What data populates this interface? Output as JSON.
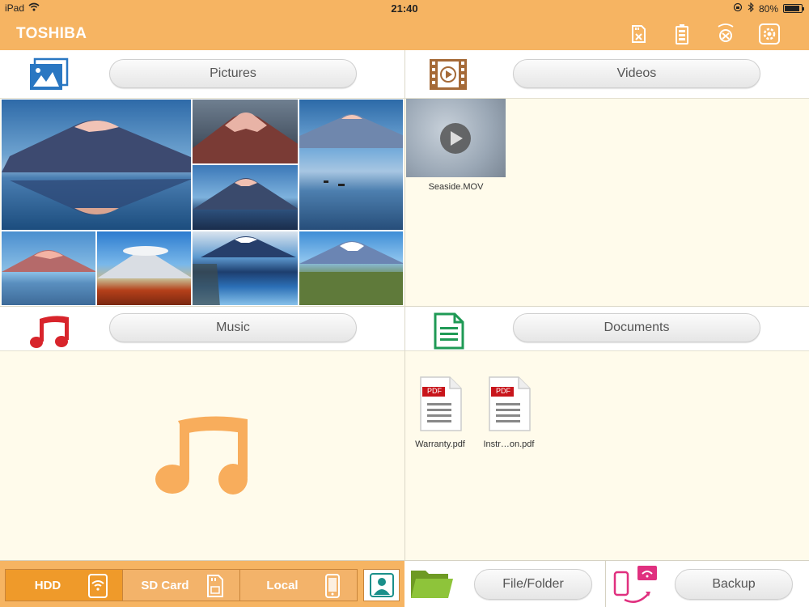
{
  "status_bar": {
    "device": "iPad",
    "time": "21:40",
    "battery": "80%"
  },
  "header": {
    "brand": "TOSHIBA",
    "icons": [
      "sd-transfer-icon",
      "battery-status-icon",
      "wifi-settings-icon",
      "settings-icon"
    ]
  },
  "categories": {
    "pictures": {
      "label": "Pictures"
    },
    "videos": {
      "label": "Videos",
      "files": [
        {
          "name": "Seaside.MOV"
        }
      ]
    },
    "music": {
      "label": "Music"
    },
    "documents": {
      "label": "Documents",
      "files": [
        {
          "name": "Warranty.pdf",
          "badge": "PDF"
        },
        {
          "name": "Instr…on.pdf",
          "badge": "PDF"
        }
      ]
    }
  },
  "bottom": {
    "storage": [
      {
        "label": "HDD",
        "active": true
      },
      {
        "label": "SD Card",
        "active": false
      },
      {
        "label": "Local",
        "active": false
      }
    ],
    "file_folder": "File/Folder",
    "backup": "Backup"
  },
  "colors": {
    "accent": "#f6b462",
    "active_segment": "#ef9a2a",
    "content_bg": "#fffbeb",
    "music_icon": "#f8ad5c"
  }
}
